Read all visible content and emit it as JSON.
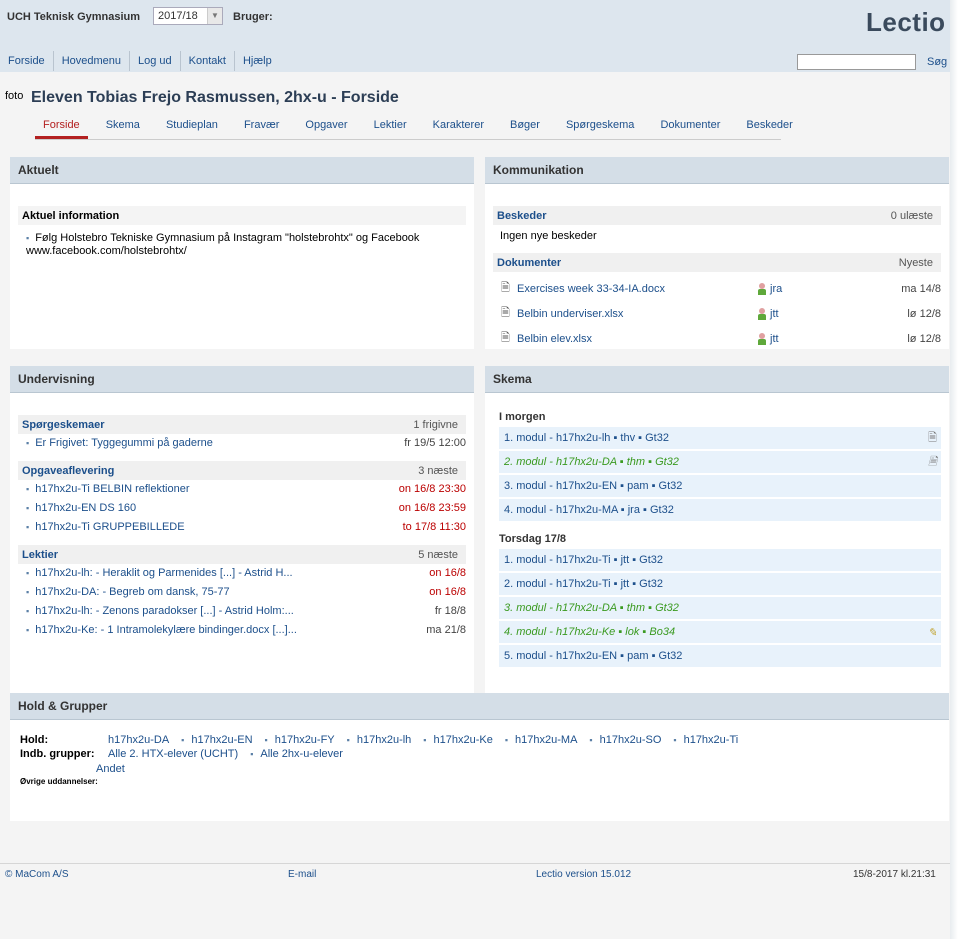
{
  "header": {
    "school": "UCH Teknisk Gymnasium",
    "year": "2017/18",
    "user_label": "Bruger:",
    "logo": "Lectio",
    "nav": [
      "Forside",
      "Hovedmenu",
      "Log ud",
      "Kontakt",
      "Hjælp"
    ],
    "search_button": "Søg",
    "search_value": ""
  },
  "page": {
    "photo": "foto",
    "title": "Eleven Tobias Frejo Rasmussen, 2hx-u - Forside",
    "tabs": [
      "Forside",
      "Skema",
      "Studieplan",
      "Fravær",
      "Opgaver",
      "Lektier",
      "Karakterer",
      "Bøger",
      "Spørgeskema",
      "Dokumenter",
      "Beskeder"
    ],
    "active_tab": "Forside"
  },
  "aktuelt": {
    "header": "Aktuelt",
    "subheader": "Aktuel information",
    "items": [
      "Følg Holstebro Tekniske Gymnasium på Instagram \"holstebrohtx\" og Facebook www.facebook.com/holstebrohtx/"
    ]
  },
  "kommunikation": {
    "header": "Kommunikation",
    "beskeder": {
      "title": "Beskeder",
      "meta": "0 ulæste",
      "empty": "Ingen nye beskeder"
    },
    "dokumenter": {
      "title": "Dokumenter",
      "meta": "Nyeste",
      "items": [
        {
          "name": "Exercises week 33-34-IA.docx",
          "person": "jra",
          "date": "ma 14/8"
        },
        {
          "name": "Belbin underviser.xlsx",
          "person": "jtt",
          "date": "lø 12/8"
        },
        {
          "name": "Belbin elev.xlsx",
          "person": "jtt",
          "date": "lø 12/8"
        }
      ]
    }
  },
  "undervisning": {
    "header": "Undervisning",
    "sections": [
      {
        "title": "Spørgeskemaer",
        "meta": "1 frigivne",
        "items": [
          {
            "text": "Er Frigivet: Tyggegummi på gaderne",
            "date": "fr 19/5 12:00",
            "red": false
          }
        ]
      },
      {
        "title": "Opgaveaflevering",
        "meta": "3 næste",
        "items": [
          {
            "text": "h17hx2u-Ti BELBIN reflektioner",
            "date": "on 16/8 23:30",
            "red": true
          },
          {
            "text": "h17hx2u-EN DS 160",
            "date": "on 16/8 23:59",
            "red": true
          },
          {
            "text": "h17hx2u-Ti GRUPPEBILLEDE",
            "date": "to 17/8 11:30",
            "red": true
          }
        ]
      },
      {
        "title": "Lektier",
        "meta": "5 næste",
        "items": [
          {
            "text": "h17hx2u-lh: - Heraklit og Parmenides [...] - Astrid H...",
            "date": "on 16/8",
            "red": true
          },
          {
            "text": "h17hx2u-DA: - Begreb om dansk, 75-77",
            "date": "on 16/8",
            "red": true
          },
          {
            "text": "h17hx2u-lh: - Zenons paradokser [...] - Astrid Holm:...",
            "date": "fr 18/8",
            "red": false
          },
          {
            "text": "h17hx2u-Ke: - 1 Intramolekylære bindinger.docx [...]...",
            "date": "ma 21/8",
            "red": false
          }
        ]
      }
    ]
  },
  "skema": {
    "header": "Skema",
    "days": [
      {
        "label": "I morgen",
        "rows": [
          {
            "text": "1. modul - h17hx2u-lh ▪ thv ▪ Gt32",
            "changed": false,
            "icon": "document-icon"
          },
          {
            "text": "2. modul - h17hx2u-DA ▪ thm ▪ Gt32",
            "changed": true,
            "icon": "document-icon"
          },
          {
            "text": "3. modul - h17hx2u-EN ▪ pam ▪ Gt32",
            "changed": false,
            "icon": ""
          },
          {
            "text": "4. modul - h17hx2u-MA ▪ jra ▪ Gt32",
            "changed": false,
            "icon": ""
          }
        ]
      },
      {
        "label": "Torsdag 17/8",
        "rows": [
          {
            "text": "1. modul - h17hx2u-Ti ▪ jtt ▪ Gt32",
            "changed": false,
            "icon": ""
          },
          {
            "text": "2. modul - h17hx2u-Ti ▪ jtt ▪ Gt32",
            "changed": false,
            "icon": ""
          },
          {
            "text": "3. modul - h17hx2u-DA ▪ thm ▪ Gt32",
            "changed": true,
            "icon": ""
          },
          {
            "text": "4. modul - h17hx2u-Ke ▪ lok ▪ Bo34",
            "changed": true,
            "icon": "note-icon"
          },
          {
            "text": "5. modul - h17hx2u-EN ▪ pam ▪ Gt32",
            "changed": false,
            "icon": ""
          }
        ]
      }
    ]
  },
  "hold": {
    "header": "Hold & Grupper",
    "hold_label": "Hold:",
    "hold_items": [
      "h17hx2u-DA",
      "h17hx2u-EN",
      "h17hx2u-FY",
      "h17hx2u-lh",
      "h17hx2u-Ke",
      "h17hx2u-MA",
      "h17hx2u-SO",
      "h17hx2u-Ti"
    ],
    "grupper_label": "Indb. grupper:",
    "grupper_items": [
      "Alle 2. HTX-elever (UCHT)",
      "Alle 2hx-u-elever"
    ],
    "andet": "Andet",
    "ovrige_label": "Øvrige uddannelser:"
  },
  "footer": {
    "copyright": "© MaCom A/S",
    "email": "E-mail",
    "version": "Lectio version 15.012",
    "timestamp": "15/8-2017  kl.21:31"
  }
}
